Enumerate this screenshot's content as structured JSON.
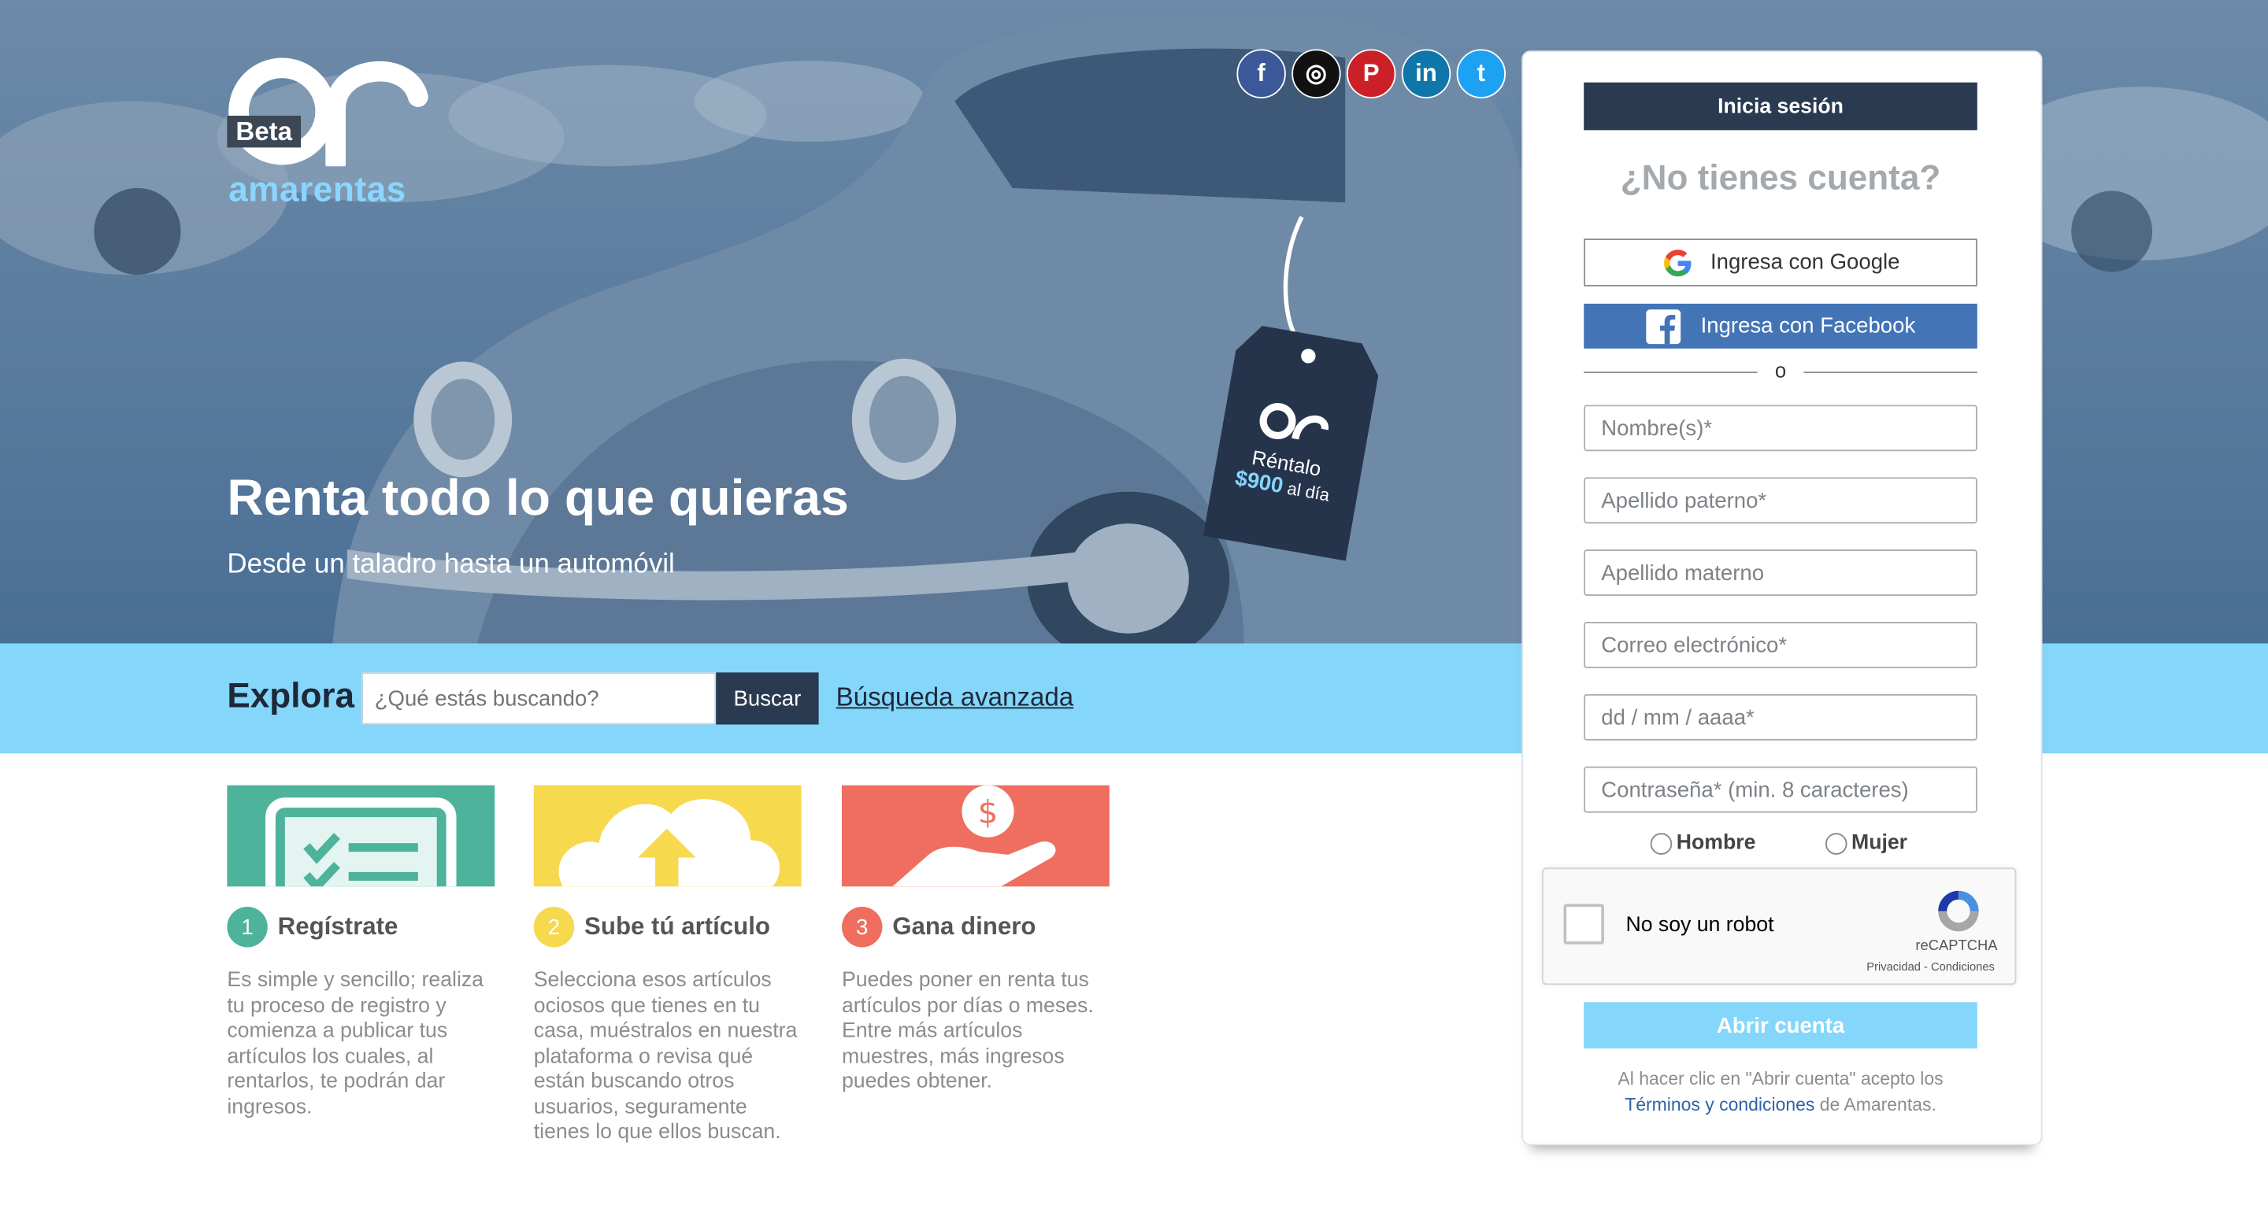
{
  "brand": {
    "beta": "Beta",
    "name": "amarentas"
  },
  "social": [
    {
      "icon": "facebook-icon",
      "glyph": "f",
      "color": "#3b5998"
    },
    {
      "icon": "instagram-icon",
      "glyph": "◎",
      "color": "#111111"
    },
    {
      "icon": "pinterest-icon",
      "glyph": "P",
      "color": "#cb2027"
    },
    {
      "icon": "linkedin-icon",
      "glyph": "in",
      "color": "#0e76a8"
    },
    {
      "icon": "twitter-icon",
      "glyph": "t",
      "color": "#1da1f2"
    }
  ],
  "hero": {
    "title": "Renta todo lo que quieras",
    "subtitle": "Desde un taladro hasta un automóvil",
    "tag_text": "Réntalo",
    "tag_price": "$900",
    "tag_unit": "al día"
  },
  "explore": {
    "label": "Explora",
    "search_placeholder": "¿Qué estás buscando?",
    "search_button": "Buscar",
    "advanced_link": "Búsqueda avanzada"
  },
  "steps": [
    {
      "num": "1",
      "title": "Regístrate",
      "color": "#4db39b",
      "text": "Es simple y sencillo; realiza tu proceso de registro y comienza a publicar tus artículos los cuales, al rentarlos, te podrán dar ingresos."
    },
    {
      "num": "2",
      "title": "Sube tú artículo",
      "color": "#f6d94d",
      "text": "Selecciona esos artículos ociosos que tienes en tu casa, muéstralos en nuestra plataforma o revisa qué están buscando otros usuarios, seguramente tienes lo que ellos buscan."
    },
    {
      "num": "3",
      "title": "Gana dinero",
      "color": "#ef6e5f",
      "text": "Puedes poner en renta tus artículos por días o meses. Entre más artículos muestres, más ingresos puedes obtener."
    }
  ],
  "signup": {
    "login_button": "Inicia sesión",
    "no_account": "¿No tienes cuenta?",
    "google_button": "Ingresa con Google",
    "facebook_button": "Ingresa con Facebook",
    "or_text": "o",
    "fields": {
      "first_name": "Nombre(s)*",
      "last_name_paternal": "Apellido paterno*",
      "last_name_maternal": "Apellido materno",
      "email": "Correo electrónico*",
      "birthdate": "dd / mm / aaaa*",
      "password": "Contraseña* (min. 8 caracteres)"
    },
    "gender": {
      "male": "Hombre",
      "female": "Mujer"
    },
    "captcha": {
      "label": "No soy un robot",
      "brand": "reCAPTCHA",
      "links": "Privacidad - Condiciones"
    },
    "open_button": "Abrir cuenta",
    "terms_prefix": "Al hacer clic en \"Abrir cuenta\" acepto los",
    "terms_link": "Términos y condiciones",
    "terms_suffix": "de Amarentas."
  }
}
